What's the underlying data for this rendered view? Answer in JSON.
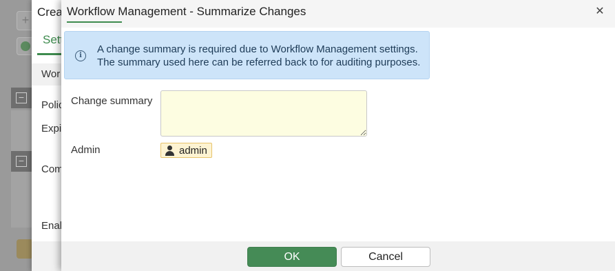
{
  "background": {
    "parent_dialog": {
      "title": "Crea",
      "active_tab": "Sett",
      "section_header": "Wor",
      "labels": [
        "Polic",
        "Expi",
        "Com",
        "Enab"
      ]
    }
  },
  "modal": {
    "title": "Workflow Management - Summarize Changes",
    "close_icon": "close-icon",
    "info": {
      "icon": "info-icon",
      "line1": "A change summary is required due to Workflow Management settings.",
      "line2": "The summary used here can be referred back to for auditing purposes."
    },
    "fields": {
      "change_summary_label": "Change summary",
      "change_summary_value": "",
      "admin_label": "Admin",
      "admin_value": "admin",
      "admin_icon": "user-icon"
    },
    "footer": {
      "ok_label": "OK",
      "cancel_label": "Cancel"
    }
  },
  "colors": {
    "accent": "#458b56",
    "info_bg": "#cde4f9",
    "textarea_bg": "#fdfde1",
    "chip_bg": "#fdf3d2"
  }
}
